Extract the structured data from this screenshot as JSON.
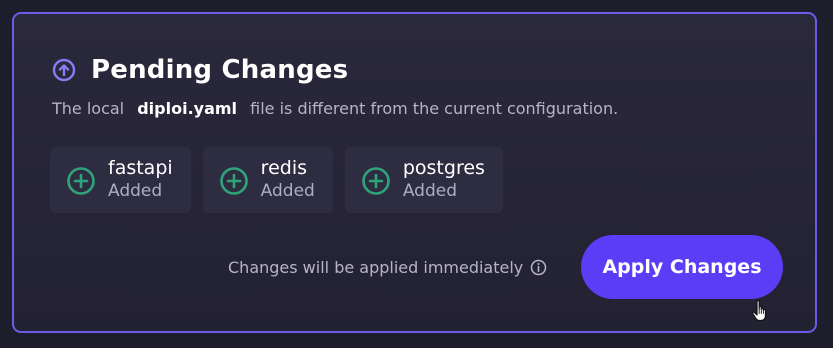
{
  "panel": {
    "title": "Pending Changes",
    "title_icon": "arrow-up-circle-icon",
    "description": {
      "prefix": "The local",
      "file": "diploi.yaml",
      "suffix": "file is different from the current configuration."
    }
  },
  "changes": [
    {
      "name": "fastapi",
      "status": "Added",
      "icon": "plus-circle-icon"
    },
    {
      "name": "redis",
      "status": "Added",
      "icon": "plus-circle-icon"
    },
    {
      "name": "postgres",
      "status": "Added",
      "icon": "plus-circle-icon"
    }
  ],
  "footer": {
    "note": "Changes will be applied immediately",
    "note_icon": "info-icon",
    "apply_label": "Apply Changes"
  },
  "colors": {
    "accent": "#5b3df5",
    "border": "#6b5ce7",
    "added_icon": "#2fa37a",
    "background": "#1e1d2b"
  }
}
